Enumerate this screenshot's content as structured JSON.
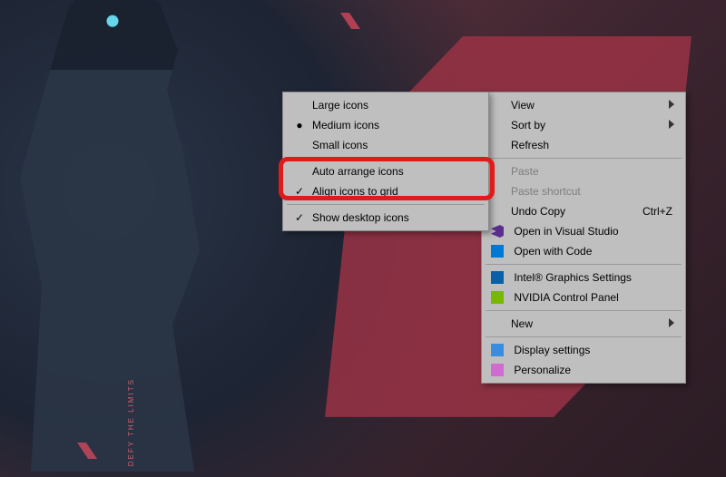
{
  "wallpaper": {
    "tagline": "DEFY THE LIMITS"
  },
  "highlight": {
    "target": "auto-arrange-icons"
  },
  "main_menu": {
    "view": {
      "label": "View"
    },
    "sort_by": {
      "label": "Sort by"
    },
    "refresh": {
      "label": "Refresh"
    },
    "paste": {
      "label": "Paste"
    },
    "paste_shortcut": {
      "label": "Paste shortcut"
    },
    "undo_copy": {
      "label": "Undo Copy",
      "shortcut": "Ctrl+Z"
    },
    "open_vs": {
      "label": "Open in Visual Studio"
    },
    "open_code": {
      "label": "Open with Code"
    },
    "intel": {
      "label": "Intel® Graphics Settings"
    },
    "nvidia": {
      "label": "NVIDIA Control Panel"
    },
    "new": {
      "label": "New"
    },
    "display": {
      "label": "Display settings"
    },
    "personalize": {
      "label": "Personalize"
    }
  },
  "view_submenu": {
    "large": {
      "label": "Large icons",
      "selected": false
    },
    "medium": {
      "label": "Medium icons",
      "selected": true
    },
    "small": {
      "label": "Small icons",
      "selected": false
    },
    "auto_arrange": {
      "label": "Auto arrange icons",
      "checked": false
    },
    "align_grid": {
      "label": "Align icons to grid",
      "checked": true
    },
    "show_desktop": {
      "label": "Show desktop icons",
      "checked": true
    }
  }
}
